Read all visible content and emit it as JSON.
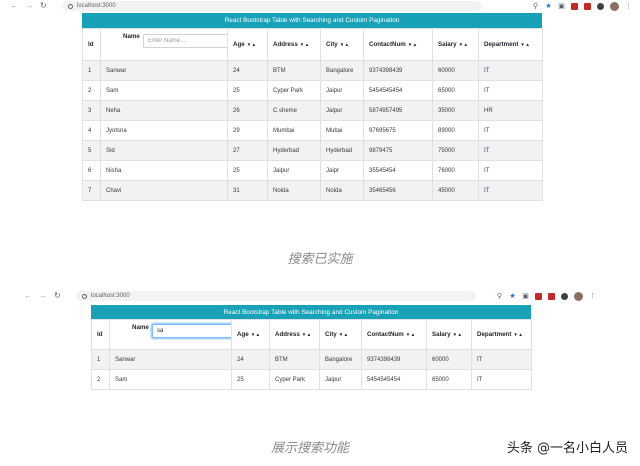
{
  "browser": {
    "url": "localhost:3000"
  },
  "app": {
    "title": "React Bootstrap Table with Searching and Custom Pagination"
  },
  "columns": [
    "Id",
    "Name",
    "Age",
    "Address",
    "City",
    "ContactNum",
    "Salary",
    "Department"
  ],
  "filter": {
    "placeholder": "Enter Name...",
    "value_after": "sa"
  },
  "rows_full": [
    [
      "1",
      "Sanwar",
      "24",
      "BTM",
      "Bangalore",
      "9374398439",
      "60000",
      "IT"
    ],
    [
      "2",
      "Sam",
      "25",
      "Cyper Park",
      "Jaipur",
      "5454545454",
      "65000",
      "IT"
    ],
    [
      "3",
      "Neha",
      "26",
      "C sheme",
      "Jaipur",
      "5874957495",
      "35000",
      "HR"
    ],
    [
      "4",
      "Jyotsna",
      "29",
      "Mumbai",
      "Mubai",
      "97695675",
      "89000",
      "IT"
    ],
    [
      "5",
      "Sid",
      "27",
      "Hyderbad",
      "Hyderbad",
      "9879475",
      "75000",
      "IT"
    ],
    [
      "6",
      "Nisha",
      "25",
      "Jaipur",
      "Jaipr",
      "35545454",
      "76000",
      "IT"
    ],
    [
      "7",
      "Chavi",
      "31",
      "Noida",
      "Noida",
      "35465456",
      "45000",
      "IT"
    ]
  ],
  "rows_filtered": [
    [
      "1",
      "Sanwar",
      "24",
      "BTM",
      "Bangalore",
      "9374398439",
      "60000",
      "IT"
    ],
    [
      "2",
      "Sam",
      "25",
      "Cyper Park",
      "Jaipur",
      "5454545454",
      "65000",
      "IT"
    ]
  ],
  "captions": {
    "top": "搜索已实施",
    "bottom": "展示搜索功能"
  },
  "watermark": "头条 @一名小白人员",
  "colors": {
    "header_bar": "#17a2b8",
    "striped_row": "#f2f2f2",
    "department_text": "#1e3fa0"
  }
}
